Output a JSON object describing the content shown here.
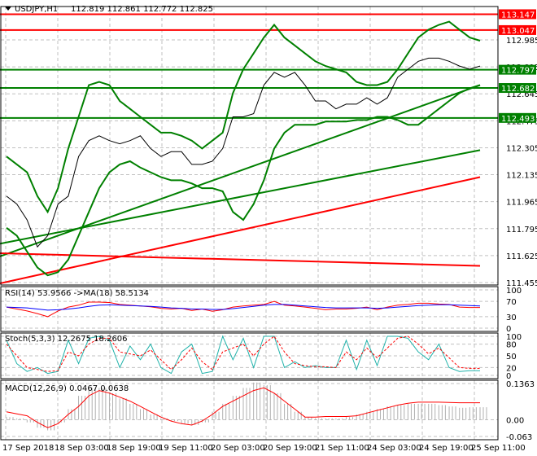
{
  "header": {
    "symbol": "USDJPY,H1",
    "ohlc": "112.819 112.861 112.772 112.825"
  },
  "colors": {
    "red": "#ff0000",
    "green": "#008000",
    "blue": "#0000ff",
    "teal": "#20b2aa",
    "grey": "#b0b0b0"
  },
  "chart_data": [
    {
      "type": "line",
      "title": "USDJPY,H1",
      "ylim": [
        111.455,
        113.155
      ],
      "yticks": [
        "112.985",
        "112.815",
        "112.645",
        "112.475",
        "112.305",
        "112.135",
        "111.965",
        "111.795",
        "111.625",
        "111.455"
      ],
      "levels": [
        {
          "label": "113.147",
          "value": 113.147,
          "color": "red"
        },
        {
          "label": "113.047",
          "value": 113.047,
          "color": "red"
        },
        {
          "label": "112.797",
          "value": 112.797,
          "color": "green"
        },
        {
          "label": "112.682",
          "value": 112.682,
          "color": "green"
        },
        {
          "label": "112.493",
          "value": 112.493,
          "color": "green"
        }
      ],
      "x": [
        0,
        1,
        2,
        3,
        4,
        5,
        6,
        7,
        8,
        9,
        10,
        11,
        12,
        13,
        14,
        15,
        16,
        17,
        18,
        19,
        20,
        21,
        22,
        23,
        24,
        25,
        26,
        27,
        28,
        29,
        30,
        31,
        32,
        33,
        34,
        35,
        36,
        37,
        38,
        39,
        40,
        41,
        42,
        43,
        44,
        45,
        46
      ],
      "series": [
        {
          "name": "close",
          "color": "black",
          "values": [
            112.0,
            111.95,
            111.85,
            111.68,
            111.75,
            111.95,
            112.0,
            112.25,
            112.35,
            112.38,
            112.35,
            112.33,
            112.35,
            112.38,
            112.3,
            112.25,
            112.28,
            112.28,
            112.2,
            112.2,
            112.22,
            112.3,
            112.5,
            112.5,
            112.52,
            112.7,
            112.78,
            112.75,
            112.78,
            112.7,
            112.6,
            112.6,
            112.55,
            112.58,
            112.58,
            112.62,
            112.58,
            112.62,
            112.75,
            112.8,
            112.85,
            112.87,
            112.87,
            112.85,
            112.82,
            112.8,
            112.82
          ]
        },
        {
          "name": "bollinger-upper",
          "color": "green",
          "values": [
            112.25,
            112.2,
            112.15,
            112.0,
            111.9,
            112.05,
            112.3,
            112.5,
            112.7,
            112.72,
            112.7,
            112.6,
            112.55,
            112.5,
            112.45,
            112.4,
            112.4,
            112.38,
            112.35,
            112.3,
            112.35,
            112.4,
            112.65,
            112.8,
            112.9,
            113.0,
            113.08,
            113.0,
            112.95,
            112.9,
            112.85,
            112.82,
            112.8,
            112.78,
            112.72,
            112.7,
            112.7,
            112.72,
            112.8,
            112.9,
            113.0,
            113.05,
            113.08,
            113.1,
            113.05,
            113.0,
            112.98
          ]
        },
        {
          "name": "bollinger-lower",
          "color": "green",
          "values": [
            111.8,
            111.75,
            111.65,
            111.55,
            111.5,
            111.52,
            111.6,
            111.75,
            111.9,
            112.05,
            112.15,
            112.2,
            112.22,
            112.18,
            112.15,
            112.12,
            112.1,
            112.1,
            112.08,
            112.05,
            112.05,
            112.03,
            111.9,
            111.85,
            111.95,
            112.1,
            112.3,
            112.4,
            112.45,
            112.45,
            112.45,
            112.47,
            112.47,
            112.47,
            112.48,
            112.48,
            112.5,
            112.5,
            112.48,
            112.45,
            112.45,
            112.5,
            112.55,
            112.6,
            112.65,
            112.68,
            112.7
          ]
        }
      ],
      "lines": [
        {
          "name": "trend-green",
          "start": 111.62,
          "end": 112.7
        },
        {
          "name": "ma-green",
          "start": 111.7,
          "end": 112.29
        },
        {
          "name": "ma-red",
          "start": 111.45,
          "end": 112.12
        },
        {
          "name": "red-flat",
          "start": 111.64,
          "end": 111.56
        }
      ]
    },
    {
      "type": "line",
      "title": "RSI(14) 53.9566  ->MA(18) 58.5134",
      "ylim": [
        0,
        100
      ],
      "yticks": [
        "100",
        "70",
        "30",
        "0"
      ],
      "series": [
        {
          "name": "RSI",
          "color": "red",
          "values": [
            55,
            50,
            45,
            38,
            30,
            45,
            55,
            60,
            68,
            68,
            67,
            62,
            60,
            58,
            56,
            52,
            50,
            52,
            46,
            50,
            44,
            48,
            55,
            58,
            60,
            62,
            70,
            60,
            58,
            55,
            52,
            48,
            50,
            50,
            52,
            55,
            48,
            55,
            60,
            62,
            65,
            65,
            63,
            62,
            55,
            54,
            54
          ]
        },
        {
          "name": "MA",
          "color": "blue",
          "values": [
            55,
            54,
            53,
            50,
            47,
            48,
            50,
            53,
            57,
            60,
            61,
            60,
            59,
            58,
            57,
            55,
            53,
            52,
            50,
            50,
            49,
            49,
            51,
            54,
            57,
            60,
            62,
            62,
            60,
            58,
            56,
            54,
            53,
            53,
            53,
            53,
            52,
            53,
            55,
            57,
            59,
            60,
            61,
            61,
            60,
            59,
            58
          ]
        }
      ]
    },
    {
      "type": "line",
      "title": "Stoch(5,3,3) 12.2675 18.2606",
      "ylim": [
        0,
        100
      ],
      "yticks": [
        "100",
        "80",
        "50",
        "20",
        "0"
      ],
      "series": [
        {
          "name": "%K",
          "color": "teal",
          "values": [
            90,
            30,
            10,
            20,
            5,
            10,
            90,
            30,
            95,
            100,
            90,
            20,
            75,
            40,
            80,
            20,
            5,
            60,
            80,
            5,
            10,
            100,
            40,
            95,
            20,
            100,
            100,
            20,
            35,
            20,
            25,
            20,
            20,
            90,
            15,
            90,
            25,
            100,
            100,
            95,
            60,
            40,
            80,
            20,
            10,
            12,
            12
          ]
        },
        {
          "name": "%D",
          "color": "red",
          "values": [
            80,
            50,
            20,
            15,
            10,
            12,
            60,
            50,
            80,
            95,
            95,
            60,
            55,
            50,
            65,
            40,
            15,
            40,
            70,
            35,
            15,
            60,
            70,
            80,
            50,
            80,
            100,
            60,
            30,
            25,
            22,
            22,
            20,
            60,
            40,
            70,
            45,
            70,
            95,
            100,
            80,
            55,
            70,
            45,
            20,
            18,
            18
          ]
        }
      ]
    },
    {
      "type": "bar",
      "title": "MACD(12,26,9) 0.0467 0.0638",
      "ylim": [
        -0.063,
        0.1363
      ],
      "yticks": [
        "0.1363",
        "0.00",
        "-0.063"
      ],
      "series": [
        {
          "name": "histogram",
          "color": "grey",
          "values": [
            0.01,
            0.005,
            -0.01,
            -0.03,
            -0.04,
            -0.01,
            0.04,
            0.09,
            0.12,
            0.12,
            0.1,
            0.08,
            0.06,
            0.04,
            0.02,
            0.005,
            -0.005,
            -0.015,
            -0.02,
            -0.01,
            0.03,
            0.06,
            0.09,
            0.12,
            0.14,
            0.13,
            0.1,
            0.06,
            0.03,
            0.01,
            0.005,
            0.005,
            0.005,
            0.01,
            0.02,
            0.03,
            0.04,
            0.05,
            0.055,
            0.06,
            0.06,
            0.06,
            0.055,
            0.05,
            0.045,
            0.047,
            0.047
          ]
        },
        {
          "name": "signal",
          "color": "red",
          "values": [
            0.03,
            0.022,
            0.015,
            -0.01,
            -0.03,
            -0.015,
            0.02,
            0.05,
            0.09,
            0.11,
            0.1,
            0.085,
            0.07,
            0.05,
            0.03,
            0.01,
            -0.005,
            -0.015,
            -0.02,
            -0.005,
            0.02,
            0.05,
            0.07,
            0.09,
            0.11,
            0.12,
            0.1,
            0.07,
            0.04,
            0.01,
            0.01,
            0.012,
            0.012,
            0.012,
            0.015,
            0.025,
            0.035,
            0.045,
            0.055,
            0.062,
            0.066,
            0.066,
            0.066,
            0.065,
            0.064,
            0.064,
            0.0638
          ]
        }
      ]
    }
  ],
  "xticks": [
    "17 Sep 2018",
    "18 Sep 03:00",
    "18 Sep 19:00",
    "19 Sep 11:00",
    "20 Sep 03:00",
    "20 Sep 19:00",
    "21 Sep 11:00",
    "24 Sep 03:00",
    "24 Sep 19:00",
    "25 Sep 11:00"
  ]
}
